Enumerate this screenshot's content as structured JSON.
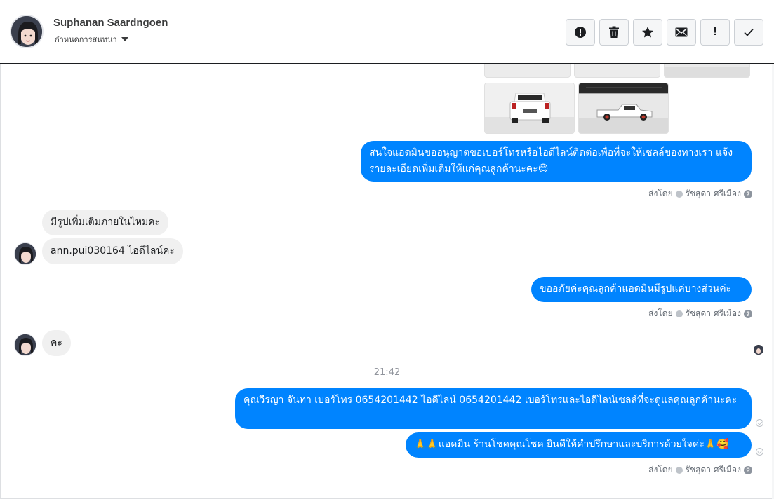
{
  "header": {
    "contact_name": "Suphanan Saardngoen",
    "subtitle": "กำหนดการสนทนา",
    "actions": [
      {
        "icon": "exclamation-circle-icon",
        "label": "spam"
      },
      {
        "icon": "trash-icon",
        "label": "delete"
      },
      {
        "icon": "star-icon",
        "label": "follow up"
      },
      {
        "icon": "envelope-icon",
        "label": "mark unread"
      },
      {
        "icon": "exclamation-icon",
        "label": "important"
      },
      {
        "icon": "checkmark-icon",
        "label": "done"
      }
    ]
  },
  "messages": {
    "out_1": "สนใจแอดมินขออนุญาตขอเบอร์โทรหรือไอดีไลน์ติดต่อเพื่อที่จะให้เซลล์ของทางเรา แจ้งรายละเอียดเพิ่มเติมให้แก่คุณลูกค้านะคะ😊",
    "in_1": "มีรูปเพิ่มเติมภายในไหมคะ",
    "in_2": "ann.pui030164 ไอดีไลน์คะ",
    "out_2": "ขออภัยค่ะคุณลูกค้าแอดมินมีรูปแค่บางส่วนค่ะ",
    "in_3": "คะ",
    "time_separator": "21:42",
    "out_3": "คุณวีรญา จันทา      เบอร์โทร 0654201442  ไอดีไลน์ 0654201442  เบอร์โทรและไอดีไลน์เซลล์ที่จะดูแลคุณลูกค้านะคะ",
    "out_4": "🙏🙏แอดมิน ร้านโชคคุณโชค ยินดีให้คำปรึกษาและบริการด้วยใจค่ะ🙏🥰"
  },
  "sent_by": {
    "prefix": "ส่งโดย",
    "agent": "รัชสุดา ศรีเมือง"
  },
  "colors": {
    "outgoing_bubble": "#0084ff",
    "incoming_bubble": "#f0f0f0"
  }
}
